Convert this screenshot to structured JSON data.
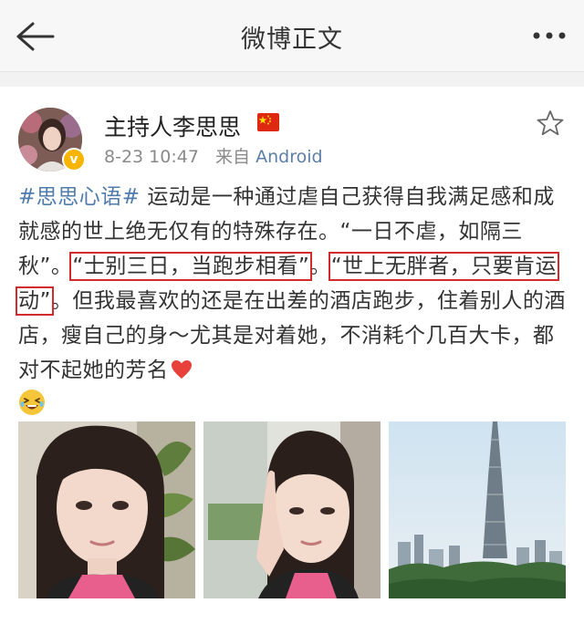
{
  "nav": {
    "title": "微博正文"
  },
  "post": {
    "username": "主持人李思思",
    "timestamp": "8-23 10:47",
    "from_label": "来自",
    "source": "Android",
    "hashtag": "#思思心语#",
    "text_a": "运动是一种通过虐自己获得自我满足感和成就感的世上绝无仅有的特殊存在。“一日不虐，如隔三秋”。",
    "quote_1": "“士别三日，当跑步相看”",
    "sep": "。",
    "quote_2": "“世上无胖者，只要肯运动”",
    "text_b": "。但我最喜欢的还是在出差的酒店跑步，住着别人的酒店，瘦自己的身～尤其是对着她，不消耗个几百大卡，都对不起她的芳名"
  },
  "icons": [
    "back-arrow-icon",
    "more-icon",
    "star-icon",
    "verified-badge-icon",
    "china-flag-icon",
    "heart-icon",
    "laughing-emoji-icon"
  ],
  "colors": {
    "link": "#4f7cad",
    "highlight_box": "#d32b2b",
    "verified": "#f7b500"
  }
}
